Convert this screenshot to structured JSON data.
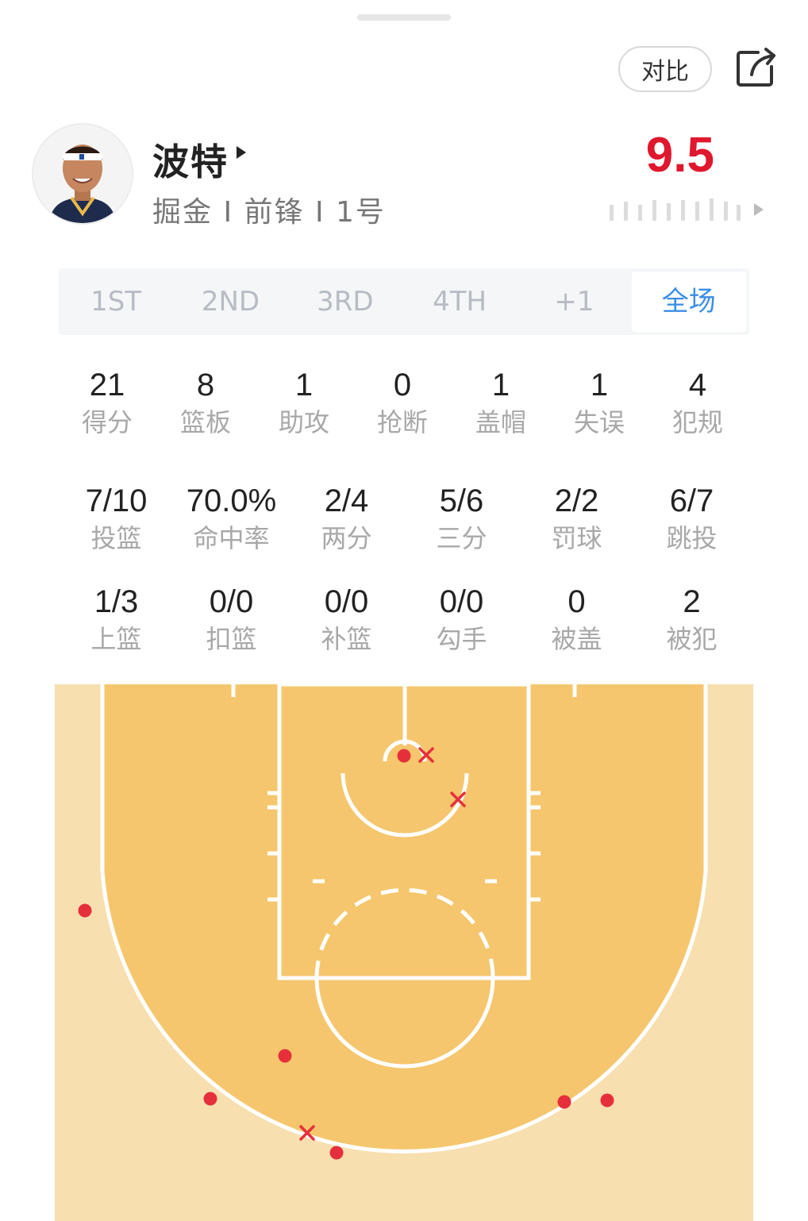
{
  "header": {
    "compare_label": "对比",
    "share_icon": "share-icon"
  },
  "player": {
    "name": "波特",
    "team": "掘金",
    "position": "前锋",
    "number": "1号",
    "meta": "掘金 I 前锋 I 1号",
    "rating": "9.5"
  },
  "tabs": [
    {
      "label": "1ST",
      "active": false
    },
    {
      "label": "2ND",
      "active": false
    },
    {
      "label": "3RD",
      "active": false
    },
    {
      "label": "4TH",
      "active": false
    },
    {
      "label": "+1",
      "active": false
    },
    {
      "label": "全场",
      "active": true
    }
  ],
  "basic_stats": [
    {
      "value": "21",
      "label": "得分"
    },
    {
      "value": "8",
      "label": "篮板"
    },
    {
      "value": "1",
      "label": "助攻"
    },
    {
      "value": "0",
      "label": "抢断"
    },
    {
      "value": "1",
      "label": "盖帽"
    },
    {
      "value": "1",
      "label": "失误"
    },
    {
      "value": "4",
      "label": "犯规"
    }
  ],
  "shooting_stats": [
    {
      "value": "7/10",
      "label": "投篮"
    },
    {
      "value": "70.0%",
      "label": "命中率"
    },
    {
      "value": "2/4",
      "label": "两分"
    },
    {
      "value": "5/6",
      "label": "三分"
    },
    {
      "value": "2/2",
      "label": "罚球"
    },
    {
      "value": "6/7",
      "label": "跳投"
    }
  ],
  "detail_stats": [
    {
      "value": "1/3",
      "label": "上篮"
    },
    {
      "value": "0/0",
      "label": "扣篮"
    },
    {
      "value": "0/0",
      "label": "补篮"
    },
    {
      "value": "0/0",
      "label": "勾手"
    },
    {
      "value": "0",
      "label": "被盖"
    },
    {
      "value": "2",
      "label": "被犯"
    }
  ],
  "colors": {
    "rating": "#e0182e",
    "active_tab": "#3a8ee6",
    "court_outer": "#f7dfb0",
    "court_inner": "#f5c66d",
    "made_shot": "#e5303c",
    "missed_shot": "#e5303c"
  }
}
